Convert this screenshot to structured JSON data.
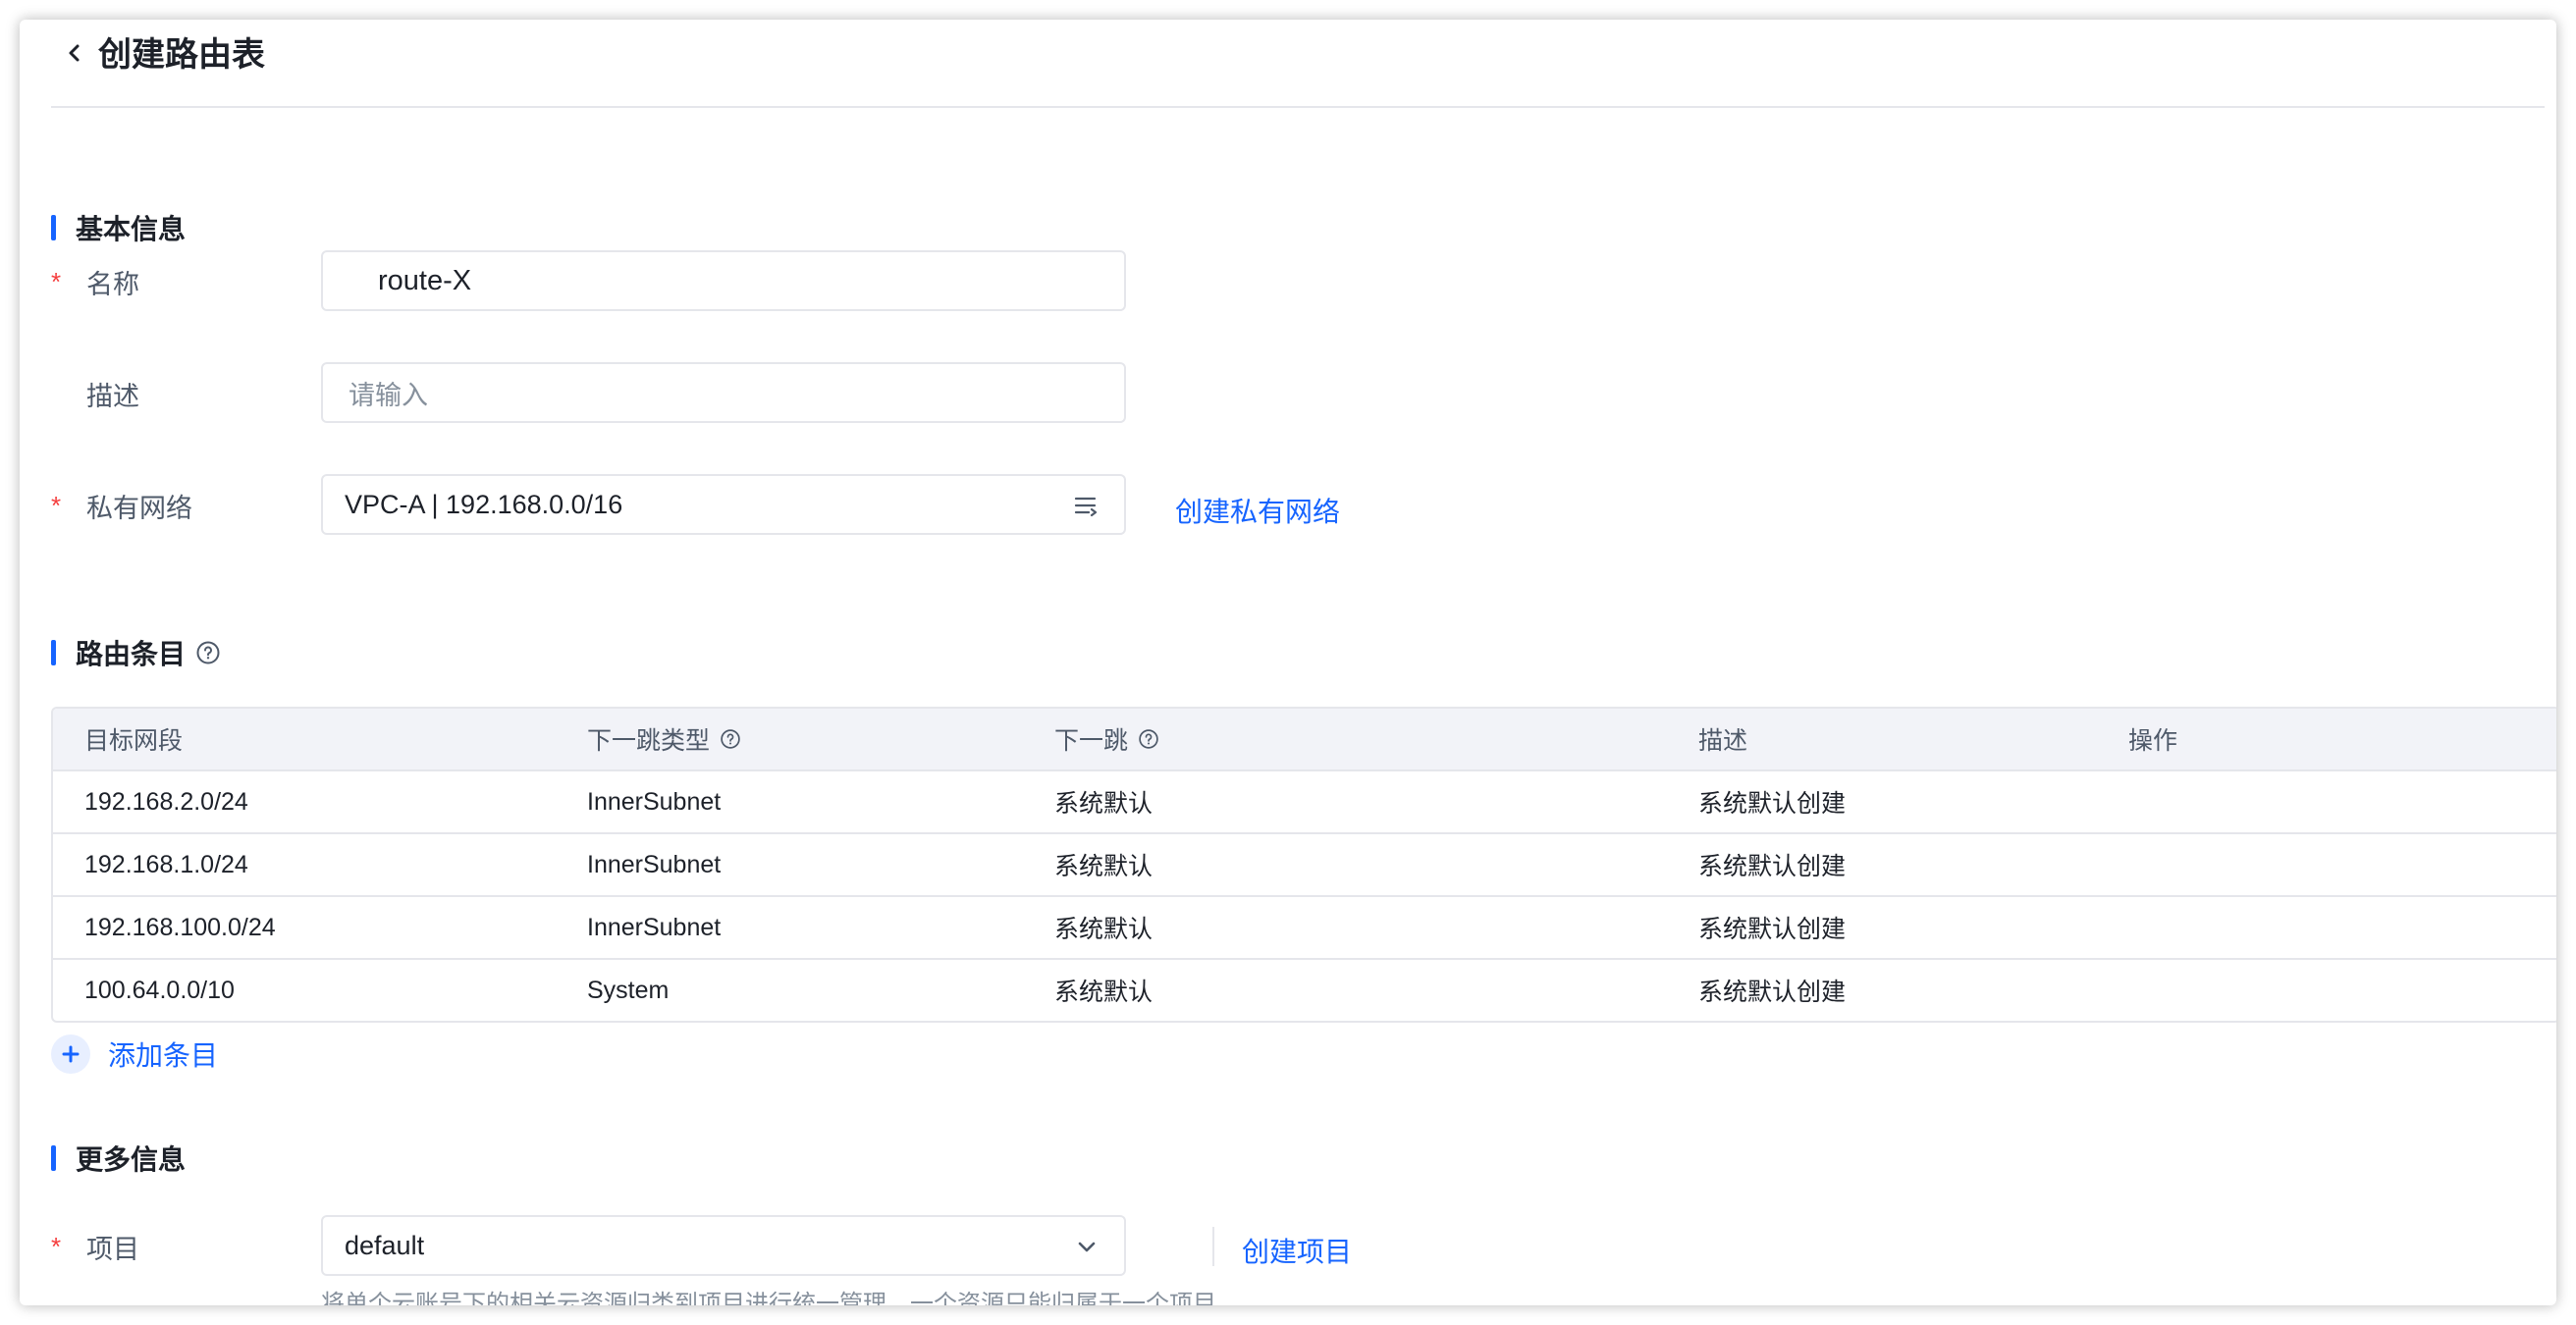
{
  "header": {
    "title": "创建路由表"
  },
  "sections": {
    "basic": "基本信息",
    "routes": "路由条目",
    "more": "更多信息"
  },
  "form": {
    "name": {
      "label": "名称",
      "value": "route-X",
      "required": "*"
    },
    "description": {
      "label": "描述",
      "placeholder": "请输入"
    },
    "vpc": {
      "label": "私有网络",
      "value": "VPC-A | 192.168.0.0/16",
      "required": "*",
      "link": "创建私有网络"
    },
    "project": {
      "label": "项目",
      "value": "default",
      "required": "*",
      "link": "创建项目",
      "hint": "将单个云账号下的相关云资源归类到项目进行统一管理，一个资源只能归属于一个项目。"
    }
  },
  "table": {
    "columns": [
      "目标网段",
      "下一跳类型",
      "下一跳",
      "描述",
      "操作"
    ],
    "rows": [
      {
        "dest": "192.168.2.0/24",
        "type": "InnerSubnet",
        "next": "系统默认",
        "desc": "系统默认创建",
        "op": ""
      },
      {
        "dest": "192.168.1.0/24",
        "type": "InnerSubnet",
        "next": "系统默认",
        "desc": "系统默认创建",
        "op": ""
      },
      {
        "dest": "192.168.100.0/24",
        "type": "InnerSubnet",
        "next": "系统默认",
        "desc": "系统默认创建",
        "op": ""
      },
      {
        "dest": "100.64.0.0/10",
        "type": "System",
        "next": "系统默认",
        "desc": "系统默认创建",
        "op": ""
      }
    ]
  },
  "add_entry": "添加条目",
  "colors": {
    "accent": "#1664ff",
    "required": "#f53f3f",
    "border": "#e5e6eb",
    "table_header_bg": "#f2f3f8"
  },
  "icons": {
    "back": "chevron-left-icon",
    "help": "question-circle-icon",
    "list": "list-select-icon",
    "dropdown": "chevron-down-icon",
    "add": "plus-icon"
  }
}
